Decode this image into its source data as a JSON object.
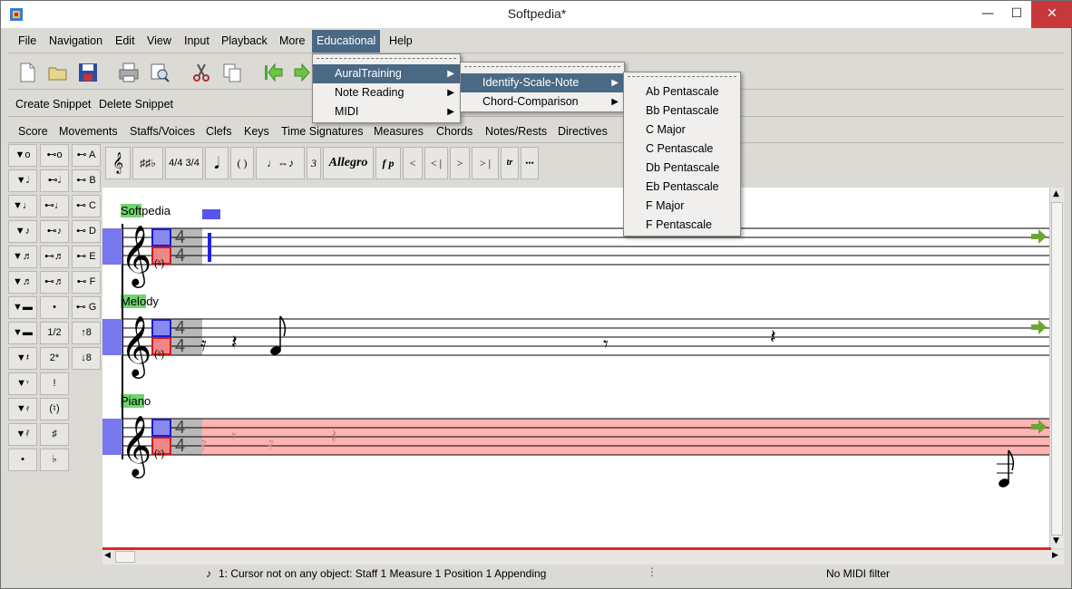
{
  "window": {
    "title": "Softpedia*",
    "min": "—",
    "max": "☐",
    "close": "✕"
  },
  "menubar": [
    "File",
    "Navigation",
    "Edit",
    "View",
    "Input",
    "Playback",
    "More",
    "Educational",
    "Help"
  ],
  "snippets": {
    "create": "Create Snippet",
    "delete": "Delete Snippet"
  },
  "categories": [
    "Score",
    "Movements",
    "Staffs/Voices",
    "Clefs",
    "Keys",
    "Time Signatures",
    "Measures",
    "Chords",
    "Notes/Rests",
    "Directives"
  ],
  "palette": {
    "col1": [
      "▼o",
      "▼𝅗𝅥",
      "▼♩",
      "▼♪",
      "▼♬",
      "▼♬",
      "▼▬",
      "▼▬",
      "▼𝄽",
      "▼𝄾",
      "▼𝄿",
      "▼𝅀",
      "•"
    ],
    "col2": [
      "⊷o",
      "⊷𝅗𝅥",
      "⊷♩",
      "⊷♪",
      "⊷♬",
      "⊷♬",
      "•",
      "1/2",
      "2*",
      "",
      "!",
      "(♮)",
      "♯",
      "♭"
    ],
    "col3": [
      "⊷ A",
      "⊷ B",
      "⊷ C",
      "⊷ D",
      "⊷ E",
      "⊷ F",
      "⊷ G",
      "↑8",
      "↓8"
    ]
  },
  "notebar": [
    "𝄞",
    "♯♯♭",
    "4/4 3/4",
    "𝅘𝅥",
    "( )",
    "♩⇔♪",
    "3",
    "Allegro",
    "f p",
    "<",
    "< |",
    ">",
    "> |",
    "tr",
    "•••"
  ],
  "score": {
    "staves": [
      {
        "label_hl": "Soft",
        "label_rest": "pedia",
        "time_top": "4",
        "time_bottom": "4",
        "nat": "(♮)"
      },
      {
        "label_hl": "Melo",
        "label_rest": "dy",
        "time_top": "4",
        "time_bottom": "4",
        "nat": "(♮)"
      },
      {
        "label_hl": "Pian",
        "label_rest": "o",
        "time_top": "4",
        "time_bottom": "4",
        "nat": "(♮)"
      }
    ]
  },
  "menus": {
    "educational": [
      "AuralTraining",
      "Note Reading",
      "MIDI"
    ],
    "auraltraining": [
      "Identify-Scale-Note",
      "Chord-Comparison"
    ],
    "scales": [
      "Ab Pentascale",
      "Bb Pentascale",
      "C Major",
      "C Pentascale",
      "Db Pentascale",
      "Eb Pentascale",
      "F Major",
      "F Pentascale"
    ]
  },
  "status": {
    "left": "1: Cursor not on any object:  Staff 1 Measure 1 Position 1 Appending",
    "right": "No MIDI filter"
  },
  "colors": {
    "menu_highlight": "#4a6984",
    "staff_highlight_blue": "#7777ee",
    "piano_band": "#ffb3b3",
    "arrow_green": "#6aa834"
  }
}
